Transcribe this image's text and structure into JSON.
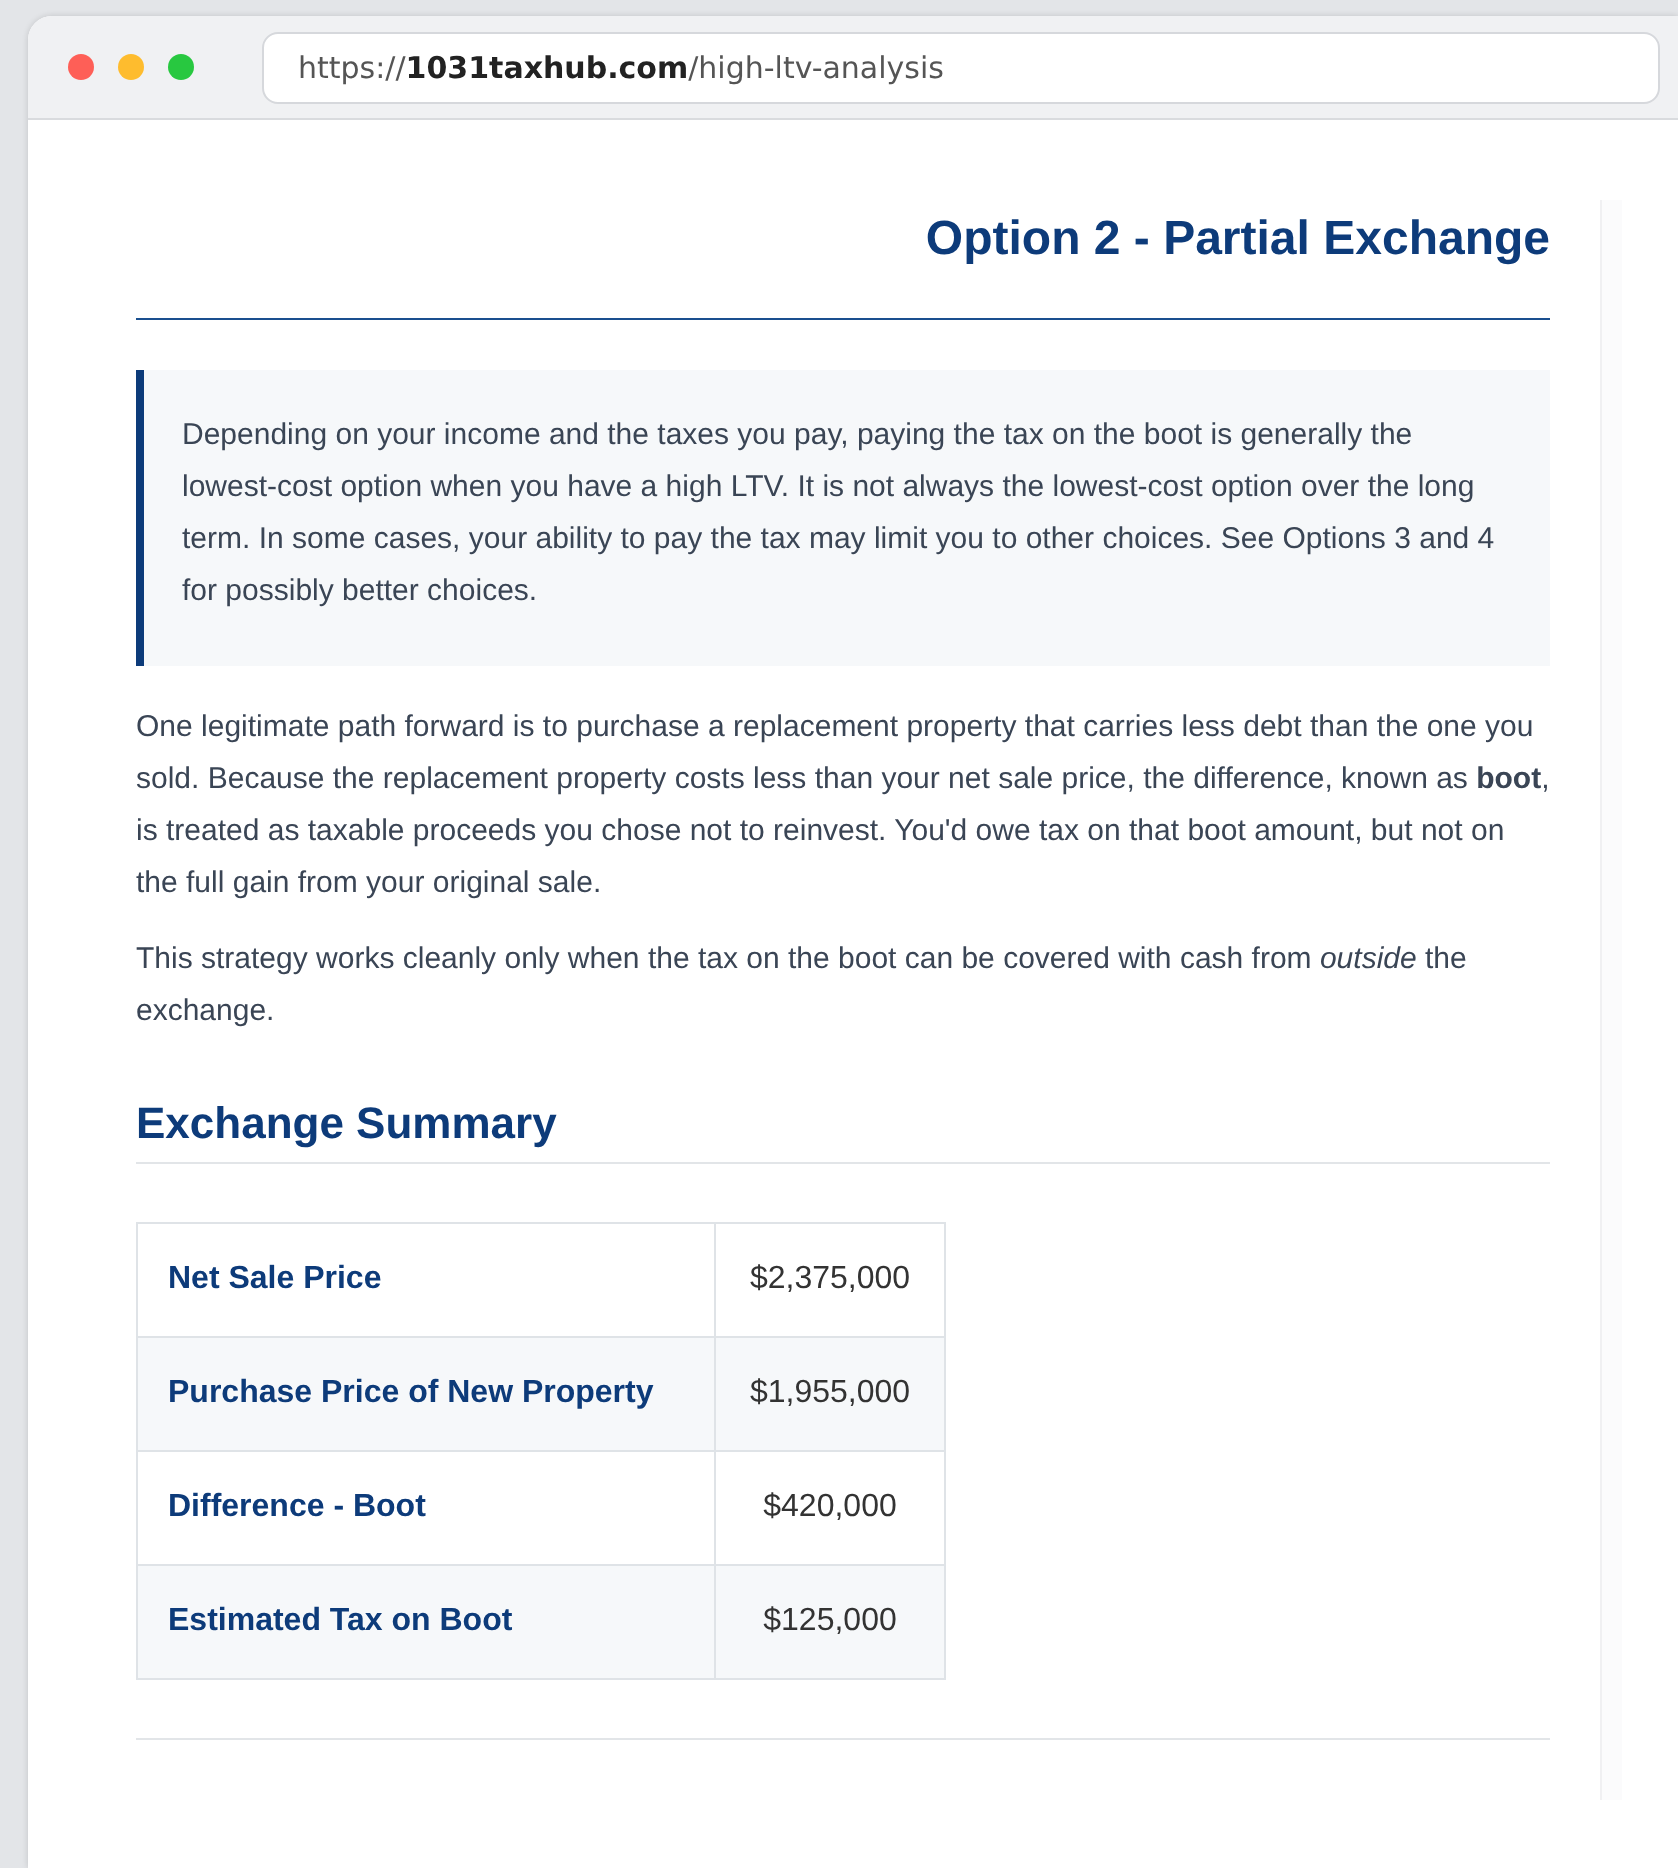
{
  "browser": {
    "url": "https://**1031taxhub.com**/high-ltv-analysis"
  },
  "article": {
    "title": "Option 2 - Partial Exchange",
    "callout": "Depending on your income and the taxes you pay, paying the tax on the boot is generally the lowest-cost option when you have a high LTV. It is not always the lowest-cost option over the long term. In some cases, your ability to pay the tax may limit you to other choices. See Options 3 and 4 for possibly better choices.",
    "paragraphs": [
      "One legitimate path forward is to purchase a replacement property that carries less debt than the one you sold. Because the replacement property costs less than your net sale price, the difference, known as **boot**, is treated as taxable proceeds you chose not to reinvest. You'd owe tax on that boot amount, but not on the full gain from your original sale.",
      "This strategy works cleanly only when the tax on the boot can be covered with cash from *outside* the exchange."
    ],
    "summary_heading": "Exchange Summary",
    "summary_rows": [
      {
        "label": "Net Sale Price",
        "value": "$2,375,000"
      },
      {
        "label": "Purchase Price of New Property",
        "value": "$1,955,000"
      },
      {
        "label": "Difference - Boot",
        "value": "$420,000"
      },
      {
        "label": "Estimated Tax on Boot",
        "value": "$125,000"
      }
    ]
  }
}
